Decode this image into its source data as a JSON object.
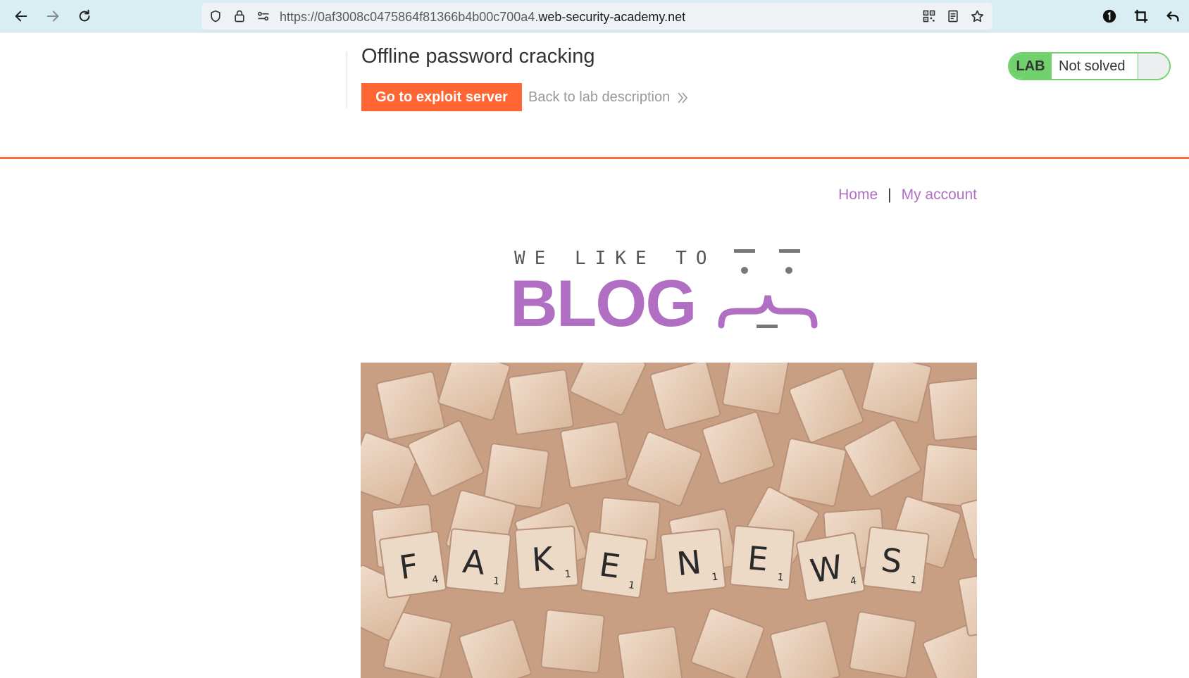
{
  "browser": {
    "url_prefix": "https://0af3008c0475864f81366b4b00c700a4.",
    "url_host": "web-security-academy.net"
  },
  "lab": {
    "title": "Offline password cracking",
    "exploit_button": "Go to exploit server",
    "back_link": "Back to lab description",
    "badge": "LAB",
    "status": "Not solved"
  },
  "nav": {
    "home": "Home",
    "separator": "|",
    "my_account": "My account"
  },
  "logo": {
    "tagline": "WE LIKE TO",
    "word": "BLOG"
  },
  "hero": {
    "tiles": [
      "F",
      "A",
      "K",
      "E",
      "N",
      "E",
      "W",
      "S"
    ],
    "tile_points": [
      "4",
      "1",
      "1",
      "1",
      "1",
      "1",
      "4",
      "1"
    ]
  },
  "colors": {
    "accent_orange": "#ff6633",
    "brand_purple": "#b06fc3",
    "lab_green": "#70d16d"
  }
}
